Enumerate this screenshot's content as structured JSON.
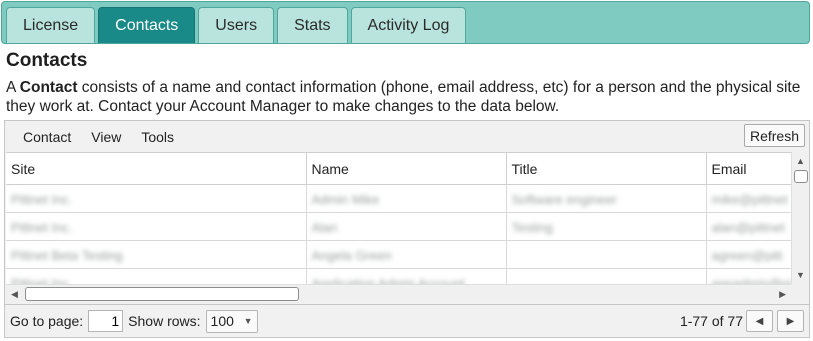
{
  "tabs": [
    {
      "label": "License",
      "active": false
    },
    {
      "label": "Contacts",
      "active": true
    },
    {
      "label": "Users",
      "active": false
    },
    {
      "label": "Stats",
      "active": false
    },
    {
      "label": "Activity Log",
      "active": false
    }
  ],
  "page": {
    "title": "Contacts",
    "description_prefix": "A ",
    "description_bold": "Contact",
    "description_rest": " consists of a name and contact information (phone, email address, etc) for a person and the physical site they work at. Contact your Account Manager to make changes to the data below."
  },
  "menubar": {
    "items": [
      "Contact",
      "View",
      "Tools"
    ],
    "refresh_label": "Refresh"
  },
  "table": {
    "columns": [
      "Site",
      "Name",
      "Title",
      "Email"
    ],
    "rows": [
      [
        "Pittnet Inc.",
        "Admin Mike",
        "Software engineer",
        "mike@pittnet"
      ],
      [
        "Pittnet Inc.",
        "Alan",
        "Testing",
        "alan@pittnet"
      ],
      [
        "Pittnet Beta Testing",
        "Angela Green",
        "",
        "agreen@pitt"
      ],
      [
        "Pittnet Inc.",
        "Application Admin Account",
        "",
        "appadmin@pi"
      ]
    ]
  },
  "pager": {
    "goto_label": "Go to page:",
    "page_value": "1",
    "rows_label": "Show rows:",
    "rows_value": "100",
    "count_text": "1-77 of 77"
  },
  "colors": {
    "tabstrip_bg": "#7fcbc1",
    "tab_active_bg": "#1a8a88",
    "tab_bg": "#b9e3dd"
  }
}
